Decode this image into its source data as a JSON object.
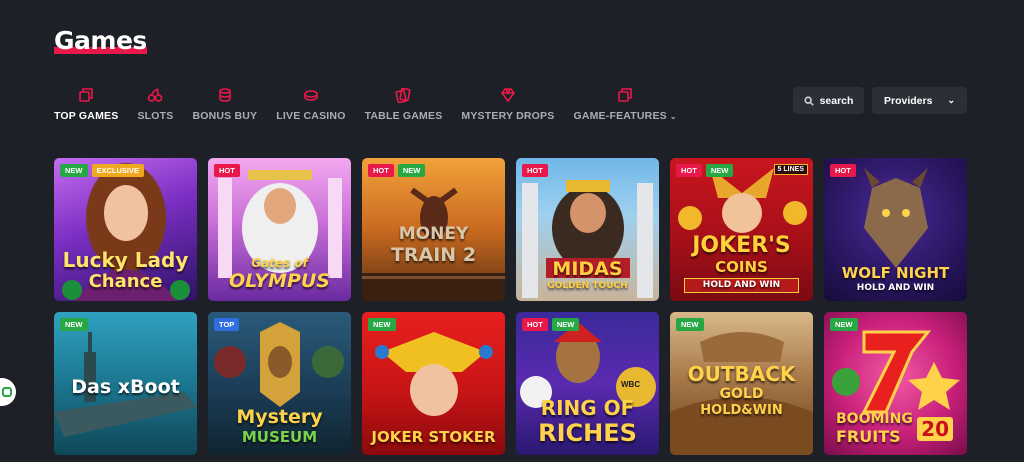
{
  "page": {
    "title": "Games"
  },
  "tabs": [
    {
      "label": "TOP GAMES",
      "icon": "top-games-icon",
      "active": true
    },
    {
      "label": "SLOTS",
      "icon": "cherries-icon",
      "active": false
    },
    {
      "label": "BONUS BUY",
      "icon": "coins-icon",
      "active": false
    },
    {
      "label": "LIVE CASINO",
      "icon": "live-casino-icon",
      "active": false
    },
    {
      "label": "TABLE GAMES",
      "icon": "cards-icon",
      "active": false
    },
    {
      "label": "MYSTERY DROPS",
      "icon": "diamond-icon",
      "active": false
    },
    {
      "label": "GAME-FEATURES",
      "icon": "features-icon",
      "active": false
    }
  ],
  "toolbar": {
    "search_label": "search",
    "providers_label": "Providers"
  },
  "colors": {
    "accent": "#e8194a",
    "background": "#1e2027",
    "new_badge": "#27a844",
    "exclusive_badge": "#f0a81e",
    "top_badge": "#2f6de0"
  },
  "games": [
    {
      "name": "Lucky Lady",
      "sub": "Chance",
      "badges": [
        "NEW",
        "EXCLUSIVE"
      ]
    },
    {
      "name": "Gates of",
      "sub": "OLYMPUS",
      "badges": [
        "HOT"
      ]
    },
    {
      "name": "MONEY",
      "sub": "TRAIN 2",
      "badges": [
        "HOT",
        "NEW"
      ]
    },
    {
      "name": "MIDAS",
      "sub": "GOLDEN TOUCH",
      "badges": [
        "HOT"
      ]
    },
    {
      "name": "JOKER'S",
      "sub": "COINS",
      "extra": "HOLD AND WIN",
      "corner": "5 LINES",
      "badges": [
        "HOT",
        "NEW"
      ]
    },
    {
      "name": "WOLF NIGHT",
      "sub": "HOLD AND WIN",
      "badges": [
        "HOT"
      ]
    },
    {
      "name": "Das xBoot",
      "sub": "",
      "badges": [
        "NEW"
      ]
    },
    {
      "name": "Mystery",
      "sub": "MUSEUM",
      "badges": [
        "TOP"
      ]
    },
    {
      "name": "JOKER STOKER",
      "sub": "",
      "badges": [
        "NEW"
      ]
    },
    {
      "name": "RING OF",
      "sub": "RICHES",
      "extra": "WBC",
      "badges": [
        "HOT",
        "NEW"
      ]
    },
    {
      "name": "OUTBACK",
      "sub": "GOLD",
      "extra": "HOLD&WIN",
      "badges": [
        "NEW"
      ]
    },
    {
      "name": "BOOMING",
      "sub": "FRUITS",
      "extra": "20",
      "badges": [
        "NEW"
      ]
    }
  ]
}
